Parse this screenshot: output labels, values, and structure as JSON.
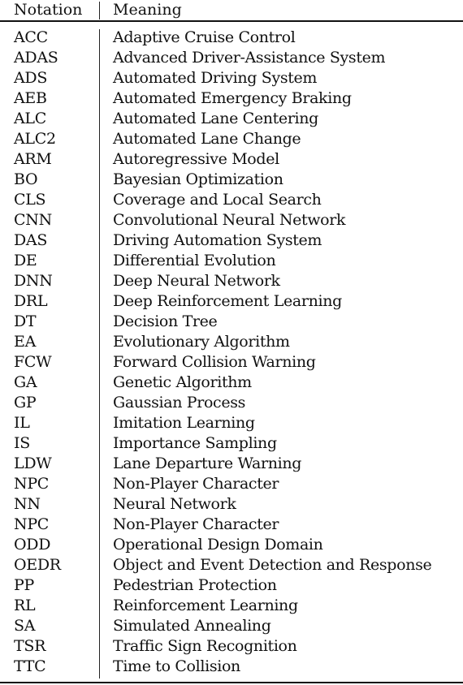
{
  "table": {
    "headers": {
      "notation": "Notation",
      "meaning": "Meaning"
    },
    "rows": [
      {
        "notation": "ACC",
        "meaning": "Adaptive Cruise Control"
      },
      {
        "notation": "ADAS",
        "meaning": "Advanced Driver-Assistance System"
      },
      {
        "notation": "ADS",
        "meaning": "Automated Driving System"
      },
      {
        "notation": "AEB",
        "meaning": "Automated Emergency Braking"
      },
      {
        "notation": "ALC",
        "meaning": "Automated Lane Centering"
      },
      {
        "notation": "ALC2",
        "meaning": "Automated Lane Change"
      },
      {
        "notation": "ARM",
        "meaning": "Autoregressive Model"
      },
      {
        "notation": "BO",
        "meaning": "Bayesian Optimization"
      },
      {
        "notation": "CLS",
        "meaning": "Coverage and Local Search"
      },
      {
        "notation": "CNN",
        "meaning": "Convolutional Neural Network"
      },
      {
        "notation": "DAS",
        "meaning": "Driving Automation System"
      },
      {
        "notation": "DE",
        "meaning": "Differential Evolution"
      },
      {
        "notation": "DNN",
        "meaning": "Deep Neural Network"
      },
      {
        "notation": "DRL",
        "meaning": "Deep Reinforcement Learning"
      },
      {
        "notation": "DT",
        "meaning": "Decision Tree"
      },
      {
        "notation": "EA",
        "meaning": "Evolutionary Algorithm"
      },
      {
        "notation": "FCW",
        "meaning": "Forward Collision Warning"
      },
      {
        "notation": "GA",
        "meaning": "Genetic Algorithm"
      },
      {
        "notation": "GP",
        "meaning": "Gaussian Process"
      },
      {
        "notation": "IL",
        "meaning": "Imitation Learning"
      },
      {
        "notation": "IS",
        "meaning": "Importance Sampling"
      },
      {
        "notation": "LDW",
        "meaning": "Lane Departure Warning"
      },
      {
        "notation": "NPC",
        "meaning": "Non-Player Character"
      },
      {
        "notation": "NN",
        "meaning": "Neural Network"
      },
      {
        "notation": "NPC",
        "meaning": "Non-Player Character"
      },
      {
        "notation": "ODD",
        "meaning": "Operational Design Domain"
      },
      {
        "notation": "OEDR",
        "meaning": "Object and Event Detection and Response"
      },
      {
        "notation": "PP",
        "meaning": "Pedestrian Protection"
      },
      {
        "notation": "RL",
        "meaning": "Reinforcement Learning"
      },
      {
        "notation": "SA",
        "meaning": "Simulated Annealing"
      },
      {
        "notation": "TSR",
        "meaning": "Traffic Sign Recognition"
      },
      {
        "notation": "TTC",
        "meaning": "Time to Collision"
      }
    ]
  }
}
